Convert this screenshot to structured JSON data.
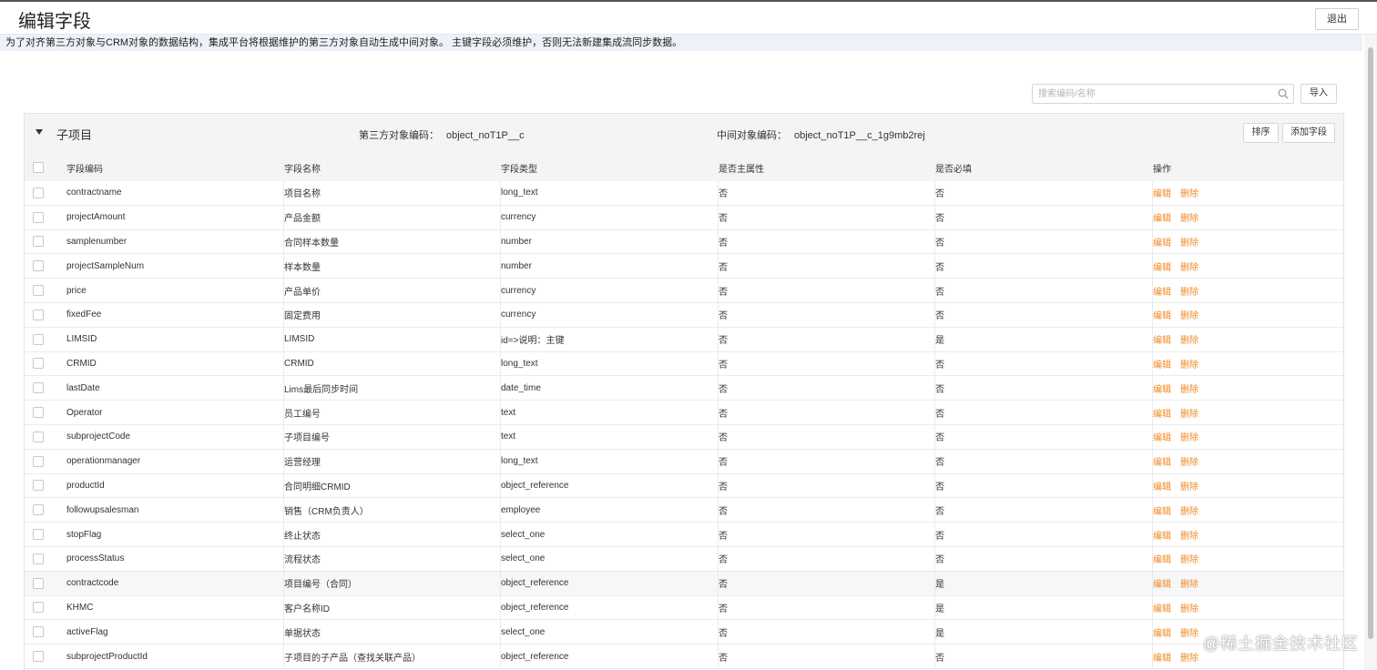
{
  "header": {
    "title": "编辑字段",
    "exit_label": "退出"
  },
  "notice": "为了对齐第三方对象与CRM对象的数据结构，集成平台将根据维护的第三方对象自动生成中间对象。 主键字段必须维护，否则无法新建集成流同步数据。",
  "toolbar": {
    "search_placeholder": "搜索编码/名称",
    "import_label": "导入"
  },
  "section": {
    "title": "子项目",
    "third_party_label": "第三方对象编码：",
    "third_party_value": "object_noT1P__c",
    "middle_label": "中间对象编码：",
    "middle_value": "object_noT1P__c_1g9mb2rej",
    "sort_label": "排序",
    "add_field_label": "添加字段"
  },
  "table": {
    "columns": {
      "code": "字段编码",
      "name": "字段名称",
      "type": "字段类型",
      "primary": "是否主属性",
      "required": "是否必填",
      "ops": "操作"
    },
    "edit_label": "编辑",
    "delete_label": "删除",
    "rows": [
      {
        "code": "contractname",
        "name": "项目名称",
        "type": "long_text",
        "primary": "否",
        "required": "否"
      },
      {
        "code": "projectAmount",
        "name": "产品金额",
        "type": "currency",
        "primary": "否",
        "required": "否"
      },
      {
        "code": "samplenumber",
        "name": "合同样本数量",
        "type": "number",
        "primary": "否",
        "required": "否"
      },
      {
        "code": "projectSampleNum",
        "name": "样本数量",
        "type": "number",
        "primary": "否",
        "required": "否"
      },
      {
        "code": "price",
        "name": "产品单价",
        "type": "currency",
        "primary": "否",
        "required": "否"
      },
      {
        "code": "fixedFee",
        "name": "固定费用",
        "type": "currency",
        "primary": "否",
        "required": "否"
      },
      {
        "code": "LIMSID",
        "name": "LIMSID",
        "type": "id=>说明：主键",
        "primary": "否",
        "required": "是"
      },
      {
        "code": "CRMID",
        "name": "CRMID",
        "type": "long_text",
        "primary": "否",
        "required": "否"
      },
      {
        "code": "lastDate",
        "name": "Lims最后同步时间",
        "type": "date_time",
        "primary": "否",
        "required": "否"
      },
      {
        "code": "Operator",
        "name": "员工编号",
        "type": "text",
        "primary": "否",
        "required": "否"
      },
      {
        "code": "subprojectCode",
        "name": "子项目编号",
        "type": "text",
        "primary": "否",
        "required": "否"
      },
      {
        "code": "operationmanager",
        "name": "运营经理",
        "type": "long_text",
        "primary": "否",
        "required": "否"
      },
      {
        "code": "productId",
        "name": "合同明细CRMID",
        "type": "object_reference",
        "primary": "否",
        "required": "否"
      },
      {
        "code": "followupsalesman",
        "name": "销售（CRM负责人）",
        "type": "employee",
        "primary": "否",
        "required": "否"
      },
      {
        "code": "stopFlag",
        "name": "终止状态",
        "type": "select_one",
        "primary": "否",
        "required": "否"
      },
      {
        "code": "processStatus",
        "name": "流程状态",
        "type": "select_one",
        "primary": "否",
        "required": "否"
      },
      {
        "code": "contractcode",
        "name": "项目编号（合同）",
        "type": "object_reference",
        "primary": "否",
        "required": "是"
      },
      {
        "code": "KHMC",
        "name": "客户名称ID",
        "type": "object_reference",
        "primary": "否",
        "required": "是"
      },
      {
        "code": "activeFlag",
        "name": "单据状态",
        "type": "select_one",
        "primary": "否",
        "required": "是"
      },
      {
        "code": "subprojectProductId",
        "name": "子项目的子产品（查找关联产品）",
        "type": "object_reference",
        "primary": "否",
        "required": "否"
      }
    ]
  },
  "watermark": "@稀土掘金技术社区",
  "colors": {
    "accent_link": "#f08a24",
    "notice_bg": "#eef1f9",
    "header_bg": "#f4f4f4"
  }
}
